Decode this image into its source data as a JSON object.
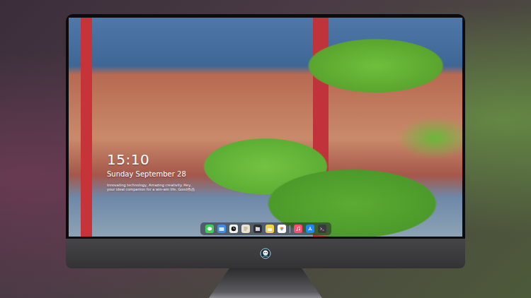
{
  "lock_screen": {
    "time": "15:10",
    "date": "Sunday September 28",
    "tagline": [
      "Innovating technology, Amazing creativity. Hey,",
      "your ideal companion for a win-win life. Good作品"
    ]
  },
  "dock": {
    "items": [
      {
        "kind": "messages"
      },
      {
        "kind": "folder"
      },
      {
        "kind": "clock"
      },
      {
        "kind": "notes"
      },
      {
        "kind": "video"
      },
      {
        "kind": "memo"
      },
      {
        "kind": "photos"
      },
      {
        "kind": "separator"
      },
      {
        "kind": "music"
      },
      {
        "kind": "store"
      },
      {
        "kind": "terminal"
      }
    ]
  }
}
